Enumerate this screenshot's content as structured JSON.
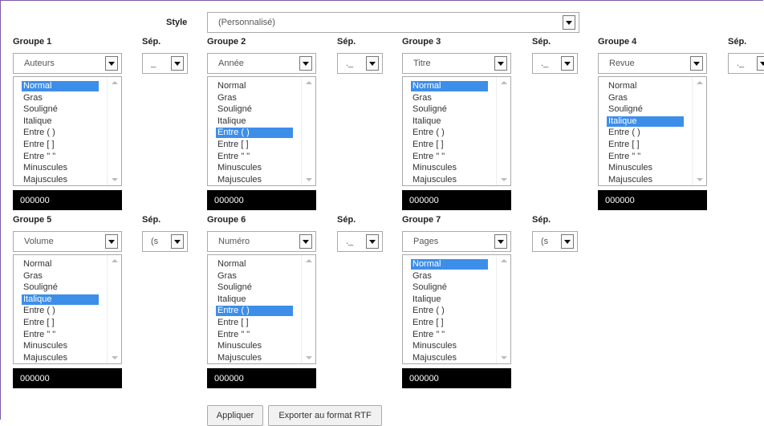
{
  "style_label": "Style",
  "style_value": "(Personnalisé)",
  "sep_label": "Sép.",
  "format_options": [
    "Normal",
    "Gras",
    "Souligné",
    "Italique",
    "Entre ( )",
    "Entre [ ]",
    "Entre \" \"",
    "Minuscules",
    "Majuscules"
  ],
  "groups": [
    {
      "label": "Groupe 1",
      "field": "Auteurs",
      "sep": "_",
      "selected": "Normal",
      "color": "000000"
    },
    {
      "label": "Groupe 2",
      "field": "Année",
      "sep": "._",
      "selected": "Entre ( )",
      "color": "000000"
    },
    {
      "label": "Groupe 3",
      "field": "Titre",
      "sep": "._",
      "selected": "Normal",
      "color": "000000"
    },
    {
      "label": "Groupe 4",
      "field": "Revue",
      "sep": "._",
      "selected": "Italique",
      "color": "000000"
    },
    {
      "label": "Groupe 5",
      "field": "Volume",
      "sep": "(s",
      "selected": "Italique",
      "color": "000000"
    },
    {
      "label": "Groupe 6",
      "field": "Numéro",
      "sep": "._",
      "selected": "Entre ( )",
      "color": "000000"
    },
    {
      "label": "Groupe 7",
      "field": "Pages",
      "sep": "(s",
      "selected": "Normal",
      "color": "000000"
    }
  ],
  "buttons": {
    "apply": "Appliquer",
    "export": "Exporter au format RTF"
  },
  "colors": {
    "selection": "#3d8ee9",
    "color_box": "#000000",
    "frame_border": "#7b5aa6"
  }
}
